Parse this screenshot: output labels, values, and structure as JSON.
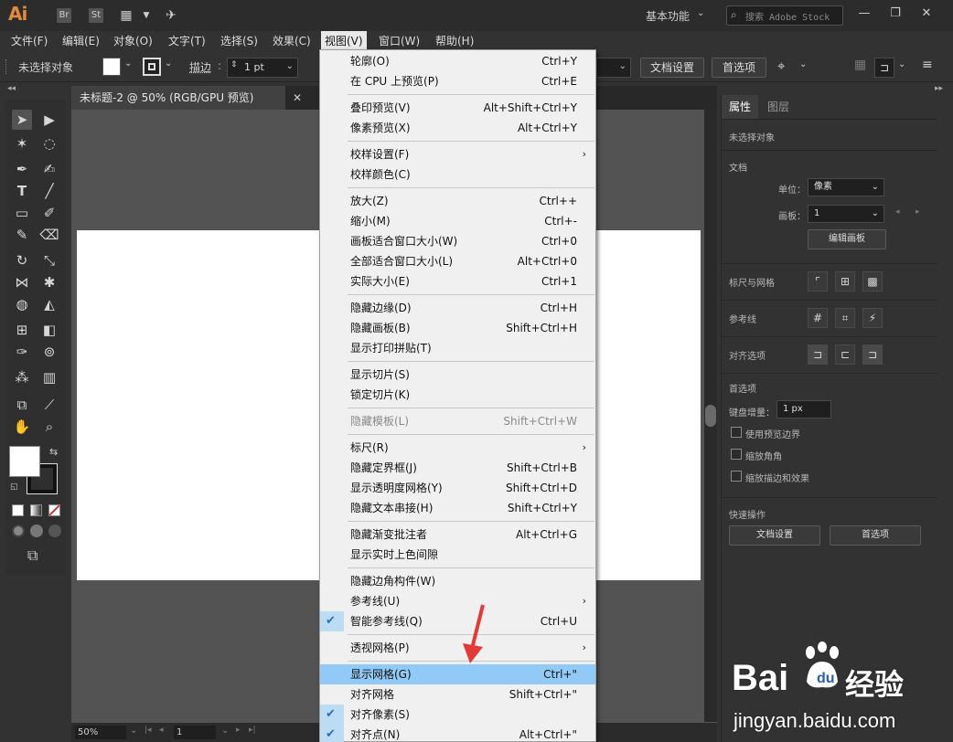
{
  "title_bar": {
    "logo": "Ai",
    "bridge": "Br",
    "stock": "St",
    "workspace": "基本功能",
    "search_placeholder": "搜索 Adobe Stock"
  },
  "menu_bar": [
    "文件(F)",
    "编辑(E)",
    "对象(O)",
    "文字(T)",
    "选择(S)",
    "效果(C)",
    "视图(V)",
    "窗口(W)",
    "帮助(H)"
  ],
  "control_bar": {
    "selection": "未选择对象",
    "stroke_label": "描边",
    "stroke_value": "1 pt",
    "doc_setup": "文档设置",
    "preferences": "首选项"
  },
  "document_tab": {
    "title": "未标题-2 @ 50% (RGB/GPU 预览)",
    "close": "✕"
  },
  "status_bar": {
    "zoom": "50%",
    "page": "1"
  },
  "view_menu": [
    {
      "label": "轮廓(O)",
      "shortcut": "Ctrl+Y"
    },
    {
      "label": "在 CPU 上预览(P)",
      "shortcut": "Ctrl+E"
    },
    {
      "sep": true
    },
    {
      "label": "叠印预览(V)",
      "shortcut": "Alt+Shift+Ctrl+Y"
    },
    {
      "label": "像素预览(X)",
      "shortcut": "Alt+Ctrl+Y"
    },
    {
      "sep": true
    },
    {
      "label": "校样设置(F)",
      "submenu": true
    },
    {
      "label": "校样颜色(C)"
    },
    {
      "sep": true
    },
    {
      "label": "放大(Z)",
      "shortcut": "Ctrl++"
    },
    {
      "label": "缩小(M)",
      "shortcut": "Ctrl+-"
    },
    {
      "label": "画板适合窗口大小(W)",
      "shortcut": "Ctrl+0"
    },
    {
      "label": "全部适合窗口大小(L)",
      "shortcut": "Alt+Ctrl+0"
    },
    {
      "label": "实际大小(E)",
      "shortcut": "Ctrl+1"
    },
    {
      "sep": true
    },
    {
      "label": "隐藏边缘(D)",
      "shortcut": "Ctrl+H"
    },
    {
      "label": "隐藏画板(B)",
      "shortcut": "Shift+Ctrl+H"
    },
    {
      "label": "显示打印拼贴(T)"
    },
    {
      "sep": true
    },
    {
      "label": "显示切片(S)"
    },
    {
      "label": "锁定切片(K)"
    },
    {
      "sep": true
    },
    {
      "label": "隐藏模板(L)",
      "shortcut": "Shift+Ctrl+W",
      "disabled": true
    },
    {
      "sep": true
    },
    {
      "label": "标尺(R)",
      "submenu": true
    },
    {
      "label": "隐藏定界框(J)",
      "shortcut": "Shift+Ctrl+B"
    },
    {
      "label": "显示透明度网格(Y)",
      "shortcut": "Shift+Ctrl+D"
    },
    {
      "label": "隐藏文本串接(H)",
      "shortcut": "Shift+Ctrl+Y"
    },
    {
      "sep": true
    },
    {
      "label": "隐藏渐变批注者",
      "shortcut": "Alt+Ctrl+G"
    },
    {
      "label": "显示实时上色间隙"
    },
    {
      "sep": true
    },
    {
      "label": "隐藏边角构件(W)"
    },
    {
      "label": "参考线(U)",
      "submenu": true
    },
    {
      "label": "智能参考线(Q)",
      "shortcut": "Ctrl+U",
      "checked": true
    },
    {
      "sep": true
    },
    {
      "label": "透视网格(P)",
      "submenu": true
    },
    {
      "sep": true
    },
    {
      "label": "显示网格(G)",
      "shortcut": "Ctrl+\"",
      "highlighted": true
    },
    {
      "label": "对齐网格",
      "shortcut": "Shift+Ctrl+\""
    },
    {
      "label": "对齐像素(S)",
      "checked": true
    },
    {
      "label": "对齐点(N)",
      "shortcut": "Alt+Ctrl+\"",
      "checked": true
    }
  ],
  "panel": {
    "tab_properties": "属性",
    "tab_layers": "图层",
    "no_selection": "未选择对象",
    "document_section": "文档",
    "units_label": "单位：",
    "units_value": "像素",
    "artboard_label": "画板：",
    "artboard_value": "1",
    "edit_artboards": "编辑画板",
    "rulers_grids": "标尺与网格",
    "guides": "参考线",
    "snap_options": "对齐选项",
    "preferences_section": "首选项",
    "keyboard_increment_label": "键盘增量：",
    "keyboard_increment_value": "1 px",
    "use_preview_bounds": "使用预览边界",
    "scale_corners": "缩放角角",
    "scale_strokes_effects": "缩放描边和效果",
    "quick_actions": "快速操作",
    "doc_setup_btn": "文档设置",
    "preferences_btn": "首选项"
  },
  "watermark": {
    "brand": "Bai",
    "brand_cn": "经验",
    "url": "jingyan.baidu.com"
  },
  "colors": {
    "app_bg": "#323232",
    "canvas": "#535353",
    "menu_bg": "#f0f0f0",
    "highlight": "#91c9f7",
    "arrow": "#e53935",
    "ai_orange": "#e3893a"
  }
}
